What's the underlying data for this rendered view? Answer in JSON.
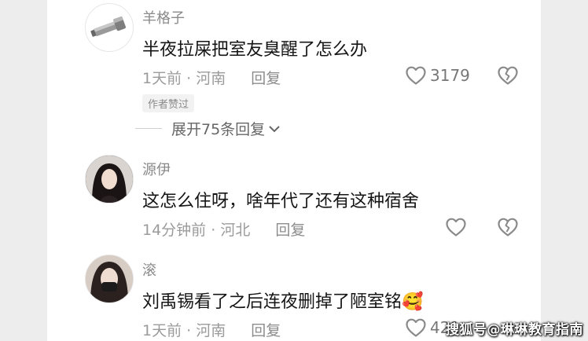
{
  "comments": [
    {
      "username": "羊格子",
      "text": "半夜拉屎把室友臭醒了怎么办",
      "time": "1天前",
      "location": "河南",
      "reply_label": "回复",
      "like_count": "3179",
      "badge": "作者赞过",
      "expand_label": "展开75条回复"
    },
    {
      "username": "源伊",
      "text": "这怎么住呀，啥年代了还有这种宿舍",
      "time": "14分钟前",
      "location": "河北",
      "reply_label": "回复",
      "like_count": ""
    },
    {
      "username": "滚",
      "text": "刘禹锡看了之后连夜删掉了陋室铭",
      "emoji": "🥰",
      "time": "1天前",
      "location": "河南",
      "reply_label": "回复",
      "like_count": "421"
    }
  ],
  "separator": "·",
  "watermark": "搜狐号@琳琳教育指南",
  "icons": [
    "flashlight-avatar",
    "heart-outline-icon",
    "broken-heart-icon",
    "chevron-down-icon"
  ],
  "colors": {
    "text": "#151515",
    "meta": "#9b9b9b",
    "icon": "#888888"
  }
}
